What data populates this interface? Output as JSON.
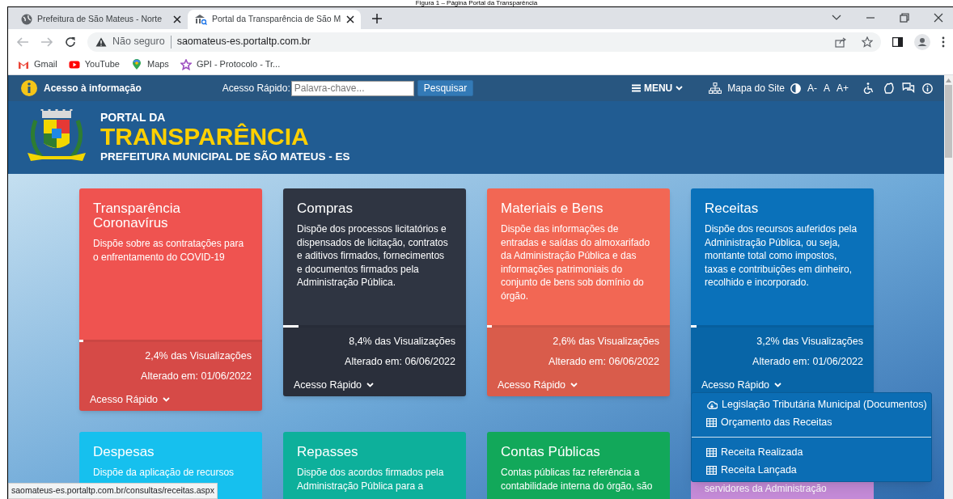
{
  "caption": "Figura 1 – Página Portal da Transparência",
  "browser": {
    "tabs": [
      {
        "title": "Prefeitura de São Mateus - Norte",
        "selected": false
      },
      {
        "title": "Portal da Transparência de São M",
        "selected": true
      }
    ],
    "security": "Não seguro",
    "url": "saomateus-es.portaltp.com.br",
    "bookmarks": [
      {
        "label": "Gmail",
        "kind": "gmail"
      },
      {
        "label": "YouTube",
        "kind": "youtube"
      },
      {
        "label": "Maps",
        "kind": "maps"
      },
      {
        "label": "GPI - Protocolo - Tr...",
        "kind": "gpi"
      }
    ],
    "status_url": "saomateus-es.portaltp.com.br/consultas/receitas.aspx"
  },
  "top_bar": {
    "info_label": "Acesso à informação",
    "quick_label": "Acesso Rápido:",
    "search_placeholder": "Palavra-chave...",
    "search_button": "Pesquisar",
    "menu": "MENU",
    "sitemap": "Mapa do Site",
    "font_buttons": [
      "A-",
      "A",
      "A+"
    ]
  },
  "header": {
    "line1": "PORTAL DA",
    "title": "TRANSPARÊNCIA",
    "subtitle": "PREFEITURA MUNICIPAL DE SÃO MATEUS - ES"
  },
  "cards": [
    {
      "title": "Transparência Coronavírus",
      "description": "Dispõe sobre as contratações para o enfrentamento do COVID-19",
      "color": "#ef5350",
      "level": 0.024,
      "views": "2,4% das Visualizações",
      "updated": "Alterado em: 01/06/2022",
      "quick_access": "Acesso Rápido"
    },
    {
      "title": "Compras",
      "description": "Dispõe dos processos licitatórios e dispensados de licitação, contratos e aditivos firmados, fornecimentos e documentos firmados pela Administração Pública.",
      "color": "#2f3542",
      "level": 0.084,
      "views": "8,4% das Visualizações",
      "updated": "Alterado em: 06/06/2022",
      "quick_access": "Acesso Rápido"
    },
    {
      "title": "Materiais e Bens",
      "description": "Dispõe das informações de entradas e saídas do almoxarifado da Administração Pública e das informações patrimoniais do conjunto de bens sob domínio do órgão.",
      "color": "#f26754",
      "level": 0.026,
      "views": "2,6% das Visualizações",
      "updated": "Alterado em: 06/06/2022",
      "quick_access": "Acesso Rápido"
    },
    {
      "title": "Receitas",
      "description": "Dispõe dos recursos auferidos pela Administração Pública, ou seja, montante total como impostos, taxas e contribuições em dinheiro, recolhido e incorporado.",
      "color": "#0a71ba",
      "level": 0.032,
      "views": "3,2% das Visualizações",
      "updated": "Alterado em: 01/06/2022",
      "quick_access": "Acesso Rápido",
      "menu": [
        [
          {
            "label": "Legislação Tributária Municipal (Documentos)",
            "kind": "cloud"
          },
          {
            "label": "Orçamento das Receitas",
            "kind": "table"
          }
        ],
        [
          {
            "label": "Receita Realizada",
            "kind": "table"
          },
          {
            "label": "Receita Lançada",
            "kind": "table"
          }
        ]
      ]
    }
  ],
  "cards_row_2": [
    {
      "title": "Despesas",
      "description": "Dispõe da aplicação de recursos",
      "color": "#16c0ee"
    },
    {
      "title": "Repasses",
      "description": "Dispõe dos acordos firmados pela Administração Pública para a",
      "color": "#0db09b"
    },
    {
      "title": "Contas Públicas",
      "description": "Contas públicas faz referência a contabilidade interna do órgão, são",
      "color": "#12a85a"
    },
    {
      "description": "servidores da Administração",
      "color": "#c58bd8"
    }
  ]
}
